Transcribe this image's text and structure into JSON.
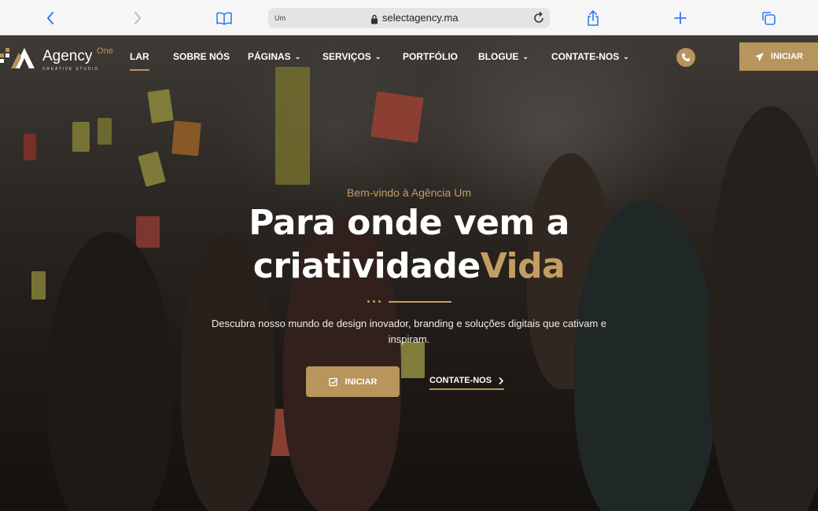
{
  "browser": {
    "tab_label": "Um",
    "url": "selectagency.ma",
    "icons": [
      "back-icon",
      "forward-icon",
      "book-icon",
      "lock-icon",
      "reload-icon",
      "share-icon",
      "plus-icon",
      "tabs-icon"
    ]
  },
  "header": {
    "logo": {
      "name": "Agency",
      "superscript": "One",
      "tagline": "CREATIVE STUDIO"
    },
    "nav": [
      {
        "label": "LAR",
        "active": true,
        "dropdown": false
      },
      {
        "label": "SOBRE NÓS",
        "active": false,
        "dropdown": false
      },
      {
        "label": "PÁGINAS",
        "active": false,
        "dropdown": true
      },
      {
        "label": "SERVIÇOS",
        "active": false,
        "dropdown": true
      },
      {
        "label": "PORTFÓLIO",
        "active": false,
        "dropdown": false
      },
      {
        "label": "BLOGUE",
        "active": false,
        "dropdown": true
      },
      {
        "label": "CONTATE-NOS",
        "active": false,
        "dropdown": true
      }
    ],
    "start_button": "INICIAR"
  },
  "hero": {
    "welcome": "Bem-vindo à Agência Um",
    "title_line1": "Para onde vem a",
    "title_line2_main": "criatividade",
    "title_line2_accent": "Vida",
    "description": "Descubra nosso mundo de design inovador, branding e soluções digitais que cativam e inspiram.",
    "primary_button": "INICIAR",
    "secondary_button": "CONTATE-NOS"
  },
  "colors": {
    "accent": "#b8955d",
    "accent_text": "#c49d62",
    "browser_bar": "#f6f6f6"
  }
}
